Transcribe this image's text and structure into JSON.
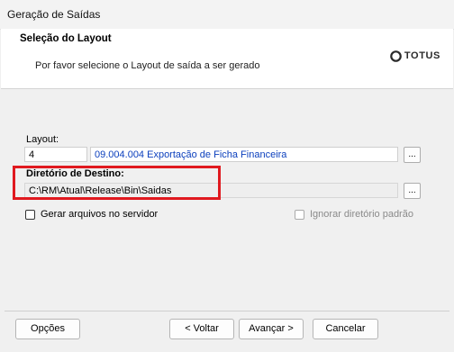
{
  "window": {
    "title": "Geração de Saídas"
  },
  "header": {
    "title": "Seleção do Layout",
    "subtitle": "Por favor selecione o Layout de saída a ser gerado",
    "logo_text": "TOTUS"
  },
  "form": {
    "layout_label": "Layout:",
    "layout_code": "4",
    "layout_name": "09.004.004 Exportação de Ficha Financeira",
    "browse_label": "...",
    "destination_label": "Diretório de Destino:",
    "destination_value": "C:\\RM\\Atual\\Release\\Bin\\Saidas",
    "server_checkbox_label": "Gerar arquivos no servidor",
    "ignore_default_dir_label": "Ignorar diretório padrão"
  },
  "footer": {
    "options_label": "Opções",
    "back_label": "< Voltar",
    "next_label": "Avançar >",
    "cancel_label": "Cancelar"
  },
  "colors": {
    "highlight_box": "#e0191f",
    "link_text": "#0b3fbd"
  }
}
